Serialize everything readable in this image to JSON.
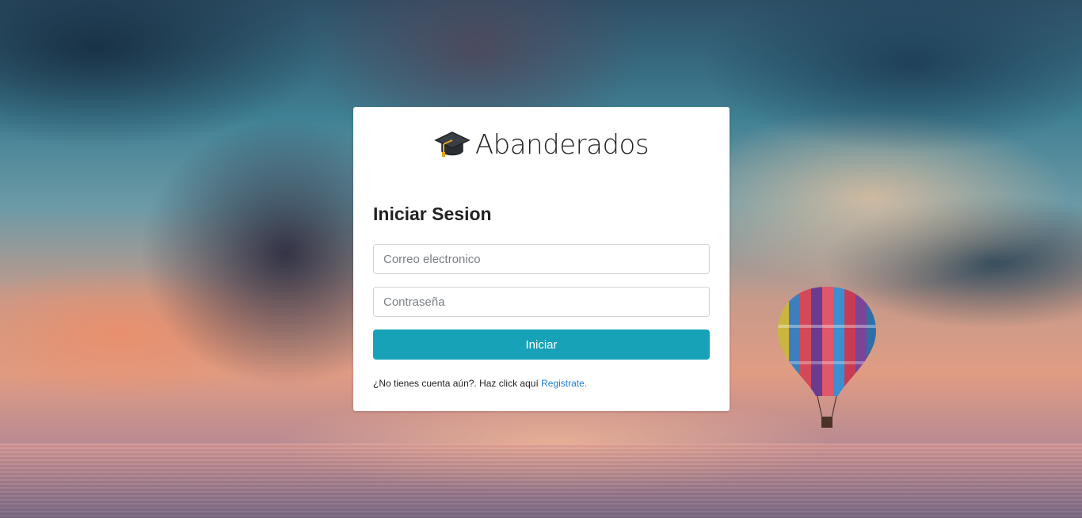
{
  "brand": {
    "name": "Abanderados",
    "icon": "graduation-cap-icon"
  },
  "login": {
    "heading": "Iniciar Sesion",
    "email_placeholder": "Correo electronico",
    "password_placeholder": "Contraseña",
    "submit_label": "Iniciar",
    "register_prompt": "¿No tienes cuenta aún?. Haz click aquí ",
    "register_link": "Registrate."
  },
  "colors": {
    "accent": "#17a2b8",
    "link": "#1a7fd6"
  }
}
